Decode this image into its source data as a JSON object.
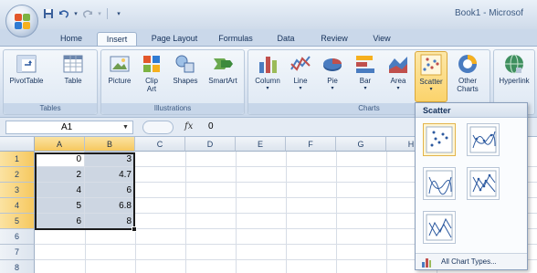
{
  "window": {
    "title": "Book1 - Microsof"
  },
  "tabs": [
    {
      "label": "Home",
      "active": false
    },
    {
      "label": "Insert",
      "active": true
    },
    {
      "label": "Page Layout",
      "active": false
    },
    {
      "label": "Formulas",
      "active": false
    },
    {
      "label": "Data",
      "active": false
    },
    {
      "label": "Review",
      "active": false
    },
    {
      "label": "View",
      "active": false
    }
  ],
  "ribbon": {
    "groups": {
      "tables": {
        "label": "Tables",
        "buttons": [
          "PivotTable",
          "Table"
        ]
      },
      "illustrations": {
        "label": "Illustrations",
        "buttons": [
          "Picture",
          "Clip Art",
          "Shapes",
          "SmartArt"
        ]
      },
      "charts": {
        "label": "Charts",
        "buttons": [
          "Column",
          "Line",
          "Pie",
          "Bar",
          "Area",
          "Scatter",
          "Other Charts"
        ]
      },
      "links": {
        "buttons": [
          "Hyperlink"
        ]
      }
    },
    "selected_button": "Scatter"
  },
  "formula_bar": {
    "name_box": "A1",
    "fx_label": "fx",
    "value": "0"
  },
  "grid": {
    "columns": [
      "A",
      "B",
      "C",
      "D",
      "E",
      "F",
      "G",
      "H"
    ],
    "rows": [
      "1",
      "2",
      "3",
      "4",
      "5",
      "6",
      "7",
      "8"
    ],
    "selected_columns": [
      "A",
      "B"
    ],
    "selected_rows": [
      "1",
      "2",
      "3",
      "4",
      "5"
    ],
    "cells": [
      [
        "0",
        "3"
      ],
      [
        "2",
        "4.7"
      ],
      [
        "4",
        "6"
      ],
      [
        "5",
        "6.8"
      ],
      [
        "6",
        "8"
      ]
    ]
  },
  "scatter_menu": {
    "header": "Scatter",
    "items": [
      {
        "name": "scatter-markers-only",
        "icon": "scatter-markers-icon"
      },
      {
        "name": "scatter-smooth-lines-markers",
        "icon": "scatter-smooth-markers-icon"
      },
      {
        "name": "scatter-smooth-lines",
        "icon": "scatter-smooth-icon"
      },
      {
        "name": "scatter-straight-lines-markers",
        "icon": "scatter-straight-markers-icon"
      },
      {
        "name": "scatter-straight-lines",
        "icon": "scatter-straight-icon"
      }
    ],
    "footer_label": "All Chart Types...",
    "footer_underline": "A"
  },
  "colors": {
    "accent": "#f6c85f",
    "selection": "#cdd6e2",
    "ribbon": "#dae4f1",
    "text": "#15315a"
  }
}
